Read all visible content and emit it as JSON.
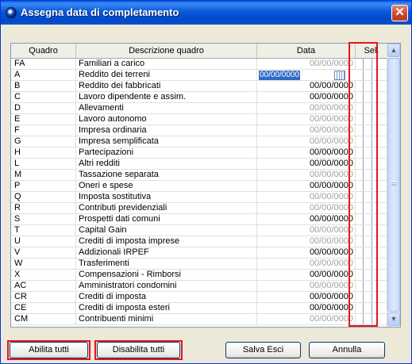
{
  "window": {
    "title": "Assegna data di completamento",
    "close_label": "✕"
  },
  "table": {
    "headers": {
      "quadro": "Quadro",
      "descrizione": "Descrizione quadro",
      "data": "Data",
      "sel": "Sel."
    },
    "editing_value": "00/00/0000",
    "rows": [
      {
        "q": "FA",
        "d": "Familiari a carico",
        "dt": "00/00/0000",
        "state": "grey"
      },
      {
        "q": "A",
        "d": "Reddito dei terreni",
        "dt": "00/00/0000",
        "state": "editing"
      },
      {
        "q": "B",
        "d": "Reddito dei fabbricati",
        "dt": "00/00/0000",
        "state": "black"
      },
      {
        "q": "C",
        "d": "Lavoro dipendente e assim.",
        "dt": "00/00/0000",
        "state": "black"
      },
      {
        "q": "D",
        "d": "Allevamenti",
        "dt": "00/00/0000",
        "state": "grey"
      },
      {
        "q": "E",
        "d": "Lavoro autonomo",
        "dt": "00/00/0000",
        "state": "grey"
      },
      {
        "q": "F",
        "d": "Impresa ordinaria",
        "dt": "00/00/0000",
        "state": "grey"
      },
      {
        "q": "G",
        "d": "Impresa semplificata",
        "dt": "00/00/0000",
        "state": "grey"
      },
      {
        "q": "H",
        "d": "Partecipazioni",
        "dt": "00/00/0000",
        "state": "black"
      },
      {
        "q": "L",
        "d": "Altri redditi",
        "dt": "00/00/0000",
        "state": "black"
      },
      {
        "q": "M",
        "d": "Tassazione separata",
        "dt": "00/00/0000",
        "state": "grey"
      },
      {
        "q": "P",
        "d": "Oneri e spese",
        "dt": "00/00/0000",
        "state": "black"
      },
      {
        "q": "Q",
        "d": "Imposta sostitutiva",
        "dt": "00/00/0000",
        "state": "grey"
      },
      {
        "q": "R",
        "d": "Contributi previdenziali",
        "dt": "00/00/0000",
        "state": "grey"
      },
      {
        "q": "S",
        "d": "Prospetti dati comuni",
        "dt": "00/00/0000",
        "state": "black"
      },
      {
        "q": "T",
        "d": "Capital Gain",
        "dt": "00/00/0000",
        "state": "grey"
      },
      {
        "q": "U",
        "d": "Crediti di imposta imprese",
        "dt": "00/00/0000",
        "state": "grey"
      },
      {
        "q": "V",
        "d": "Addizionali IRPEF",
        "dt": "00/00/0000",
        "state": "black"
      },
      {
        "q": "W",
        "d": "Trasferimenti",
        "dt": "00/00/0000",
        "state": "grey"
      },
      {
        "q": "X",
        "d": "Compensazioni - Rimborsi",
        "dt": "00/00/0000",
        "state": "black"
      },
      {
        "q": "AC",
        "d": "Amministratori condomini",
        "dt": "00/00/0000",
        "state": "grey"
      },
      {
        "q": "CR",
        "d": "Crediti di imposta",
        "dt": "00/00/0000",
        "state": "black"
      },
      {
        "q": "CE",
        "d": "Crediti di imposta esteri",
        "dt": "00/00/0000",
        "state": "black"
      },
      {
        "q": "CM",
        "d": "Contribuenti minimi",
        "dt": "00/00/0000",
        "state": "grey"
      }
    ]
  },
  "scrollbar": {
    "up": "▲",
    "down": "▼"
  },
  "buttons": {
    "abilita_tutti": "Abilita tutti",
    "disabilita_tutti": "Disabilita tutti",
    "salva_esci": "Salva Esci",
    "annulla": "Annulla"
  },
  "colors": {
    "highlight": "#e6141d",
    "title_bar": "#0a58d8"
  }
}
